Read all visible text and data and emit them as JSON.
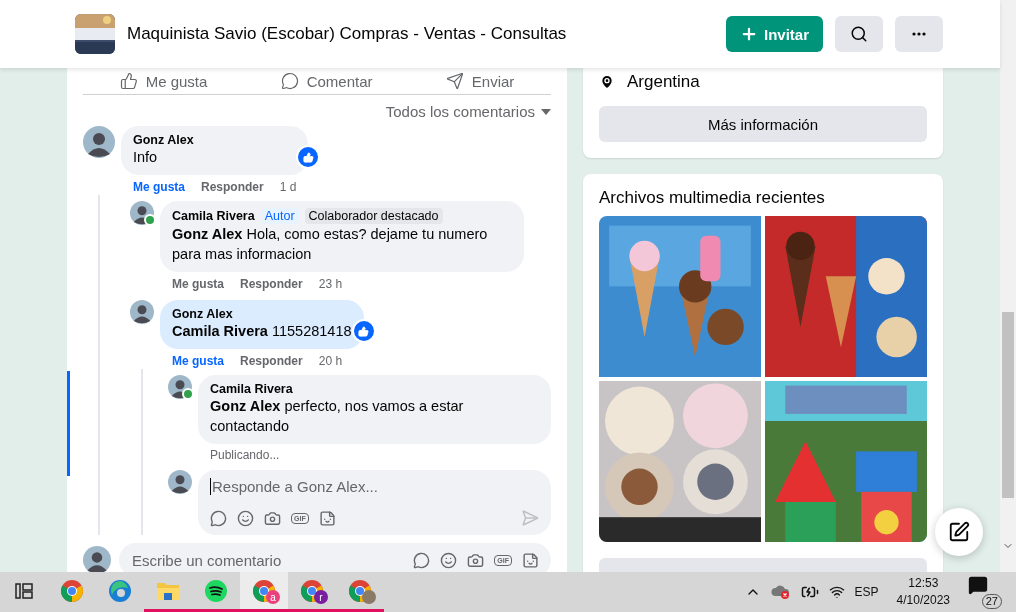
{
  "header": {
    "title": "Maquinista Savio (Escobar) Compras - Ventas - Consultas",
    "invite_button": "Invitar"
  },
  "post_actions": [
    {
      "kind": "like",
      "label": "Me gusta"
    },
    {
      "kind": "comment",
      "label": "Comentar"
    },
    {
      "kind": "send",
      "label": "Enviar"
    }
  ],
  "comment_filter": "Todos los comentarios",
  "comments": [
    {
      "author": "Gonz Alex",
      "text": "Info",
      "reaction": true,
      "liked": true,
      "highlighted": false,
      "like_label": "Me gusta",
      "reply_label": "Responder",
      "time": "1 d",
      "children": [
        {
          "author": "Camila Rivera",
          "mention": "Gonz Alex",
          "text": "Hola, como estas? dejame tu numero para mas informacion",
          "online": true,
          "liked": false,
          "highlighted": false,
          "badges": [
            {
              "kind": "author",
              "label": "Autor"
            },
            {
              "kind": "top",
              "label": "Colaborador destacado"
            }
          ],
          "like_label": "Me gusta",
          "reply_label": "Responder",
          "time": "23 h"
        },
        {
          "author": "Gonz Alex",
          "mention": "Camila Rivera",
          "text": "1155281418",
          "reaction": true,
          "liked": true,
          "highlighted": true,
          "like_label": "Me gusta",
          "reply_label": "Responder",
          "time": "20 h",
          "children": [
            {
              "author": "Camila Rivera",
              "mention": "Gonz Alex",
              "text": "perfecto, nos vamos a estar contactando",
              "online": true,
              "highlighted": false,
              "focused": true,
              "status": "Publicando..."
            }
          ],
          "reply_composer": {
            "placeholder": "Responde a Gonz Alex...",
            "gif_label": "GIF"
          }
        }
      ]
    }
  ],
  "comment_composer": {
    "placeholder": "Escribe un comentario",
    "gif_label": "GIF"
  },
  "about_card": {
    "location": "Argentina",
    "button": "Más información"
  },
  "media_card": {
    "title": "Archivos multimedia recientes"
  },
  "taskbar": {
    "apps": [
      {
        "kind": "taskview",
        "running": false,
        "selected": false
      },
      {
        "kind": "chrome",
        "running": false,
        "selected": false
      },
      {
        "kind": "edge",
        "running": false,
        "selected": false
      },
      {
        "kind": "folder",
        "running": true,
        "selected": false
      },
      {
        "kind": "spotify",
        "running": true,
        "selected": false
      },
      {
        "kind": "chrome",
        "badge": "a",
        "color": "#e8417e",
        "running": true,
        "selected": true
      },
      {
        "kind": "chrome",
        "badge": "r",
        "color": "#7a1fa2",
        "running": true,
        "selected": false
      },
      {
        "kind": "chrome-photo",
        "running": true,
        "selected": false
      }
    ],
    "language": "ESP",
    "time": "12:53",
    "date": "4/10/2023",
    "notifications": "27"
  }
}
